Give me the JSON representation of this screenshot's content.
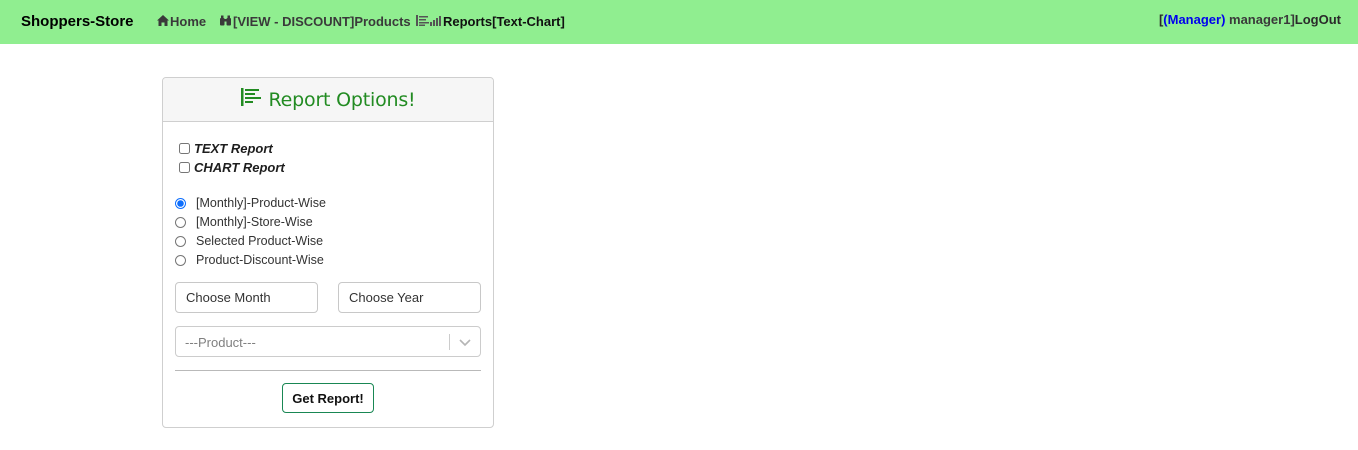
{
  "navbar": {
    "brand": "Shoppers-Store",
    "links": [
      {
        "label": "Home",
        "icon": "home-icon"
      },
      {
        "label": "[VIEW - DISCOUNT]Products",
        "icon": "binoculars-icon"
      },
      {
        "label": "Reports[Text-Chart]",
        "icon": "reports-icon"
      }
    ],
    "user": {
      "open_bracket": "[",
      "role": "(Manager)",
      "name": " manager1]",
      "logout": "LogOut"
    }
  },
  "card": {
    "title": "Report Options!",
    "checkboxes": [
      {
        "label": "TEXT Report",
        "checked": false
      },
      {
        "label": "CHART Report",
        "checked": false
      }
    ],
    "radios": [
      {
        "label": "[Monthly]-Product-Wise",
        "checked": true
      },
      {
        "label": "[Monthly]-Store-Wise",
        "checked": false
      },
      {
        "label": "Selected Product-Wise",
        "checked": false
      },
      {
        "label": "Product-Discount-Wise",
        "checked": false
      }
    ],
    "month_placeholder": "Choose Month",
    "year_placeholder": "Choose Year",
    "product_select": "---Product---",
    "button": "Get Report!"
  },
  "colors": {
    "navbar_bg": "#90ee90",
    "title": "#228b22",
    "role": "#0000ee",
    "button_border": "#198754"
  }
}
